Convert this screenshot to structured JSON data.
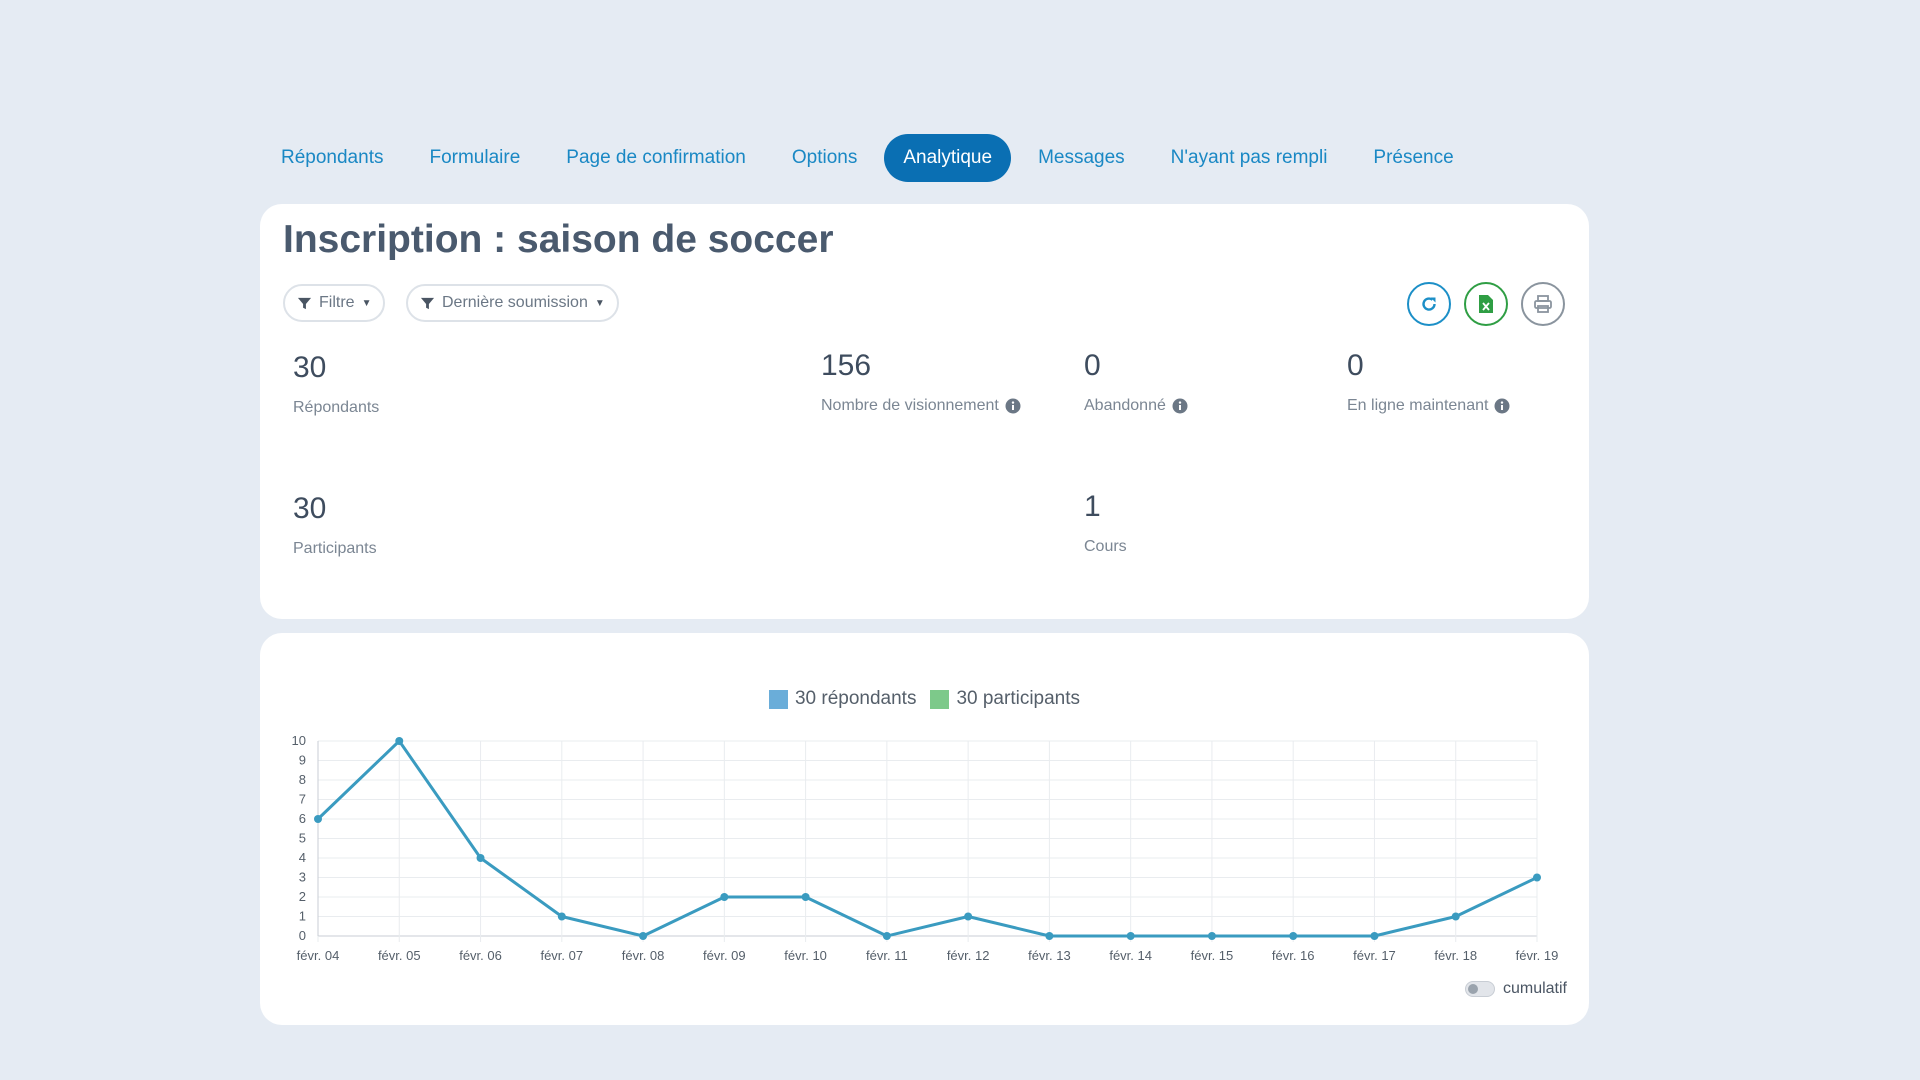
{
  "tabs": [
    {
      "label": "Répondants",
      "active": false
    },
    {
      "label": "Formulaire",
      "active": false
    },
    {
      "label": "Page de confirmation",
      "active": false
    },
    {
      "label": "Options",
      "active": false
    },
    {
      "label": "Analytique",
      "active": true
    },
    {
      "label": "Messages",
      "active": false
    },
    {
      "label": "N'ayant pas rempli",
      "active": false
    },
    {
      "label": "Présence",
      "active": false
    }
  ],
  "summary": {
    "title": "Inscription : saison de soccer",
    "filter_label": "Filtre",
    "sort_label": "Dernière soumission",
    "actions": {
      "refresh_icon": "refresh-icon",
      "excel_icon": "excel-icon",
      "print_icon": "print-icon"
    },
    "stats": {
      "respondents": {
        "value": "30",
        "label": "Répondants"
      },
      "views": {
        "value": "156",
        "label": "Nombre de visionnement"
      },
      "abandoned": {
        "value": "0",
        "label": "Abandonné"
      },
      "online": {
        "value": "0",
        "label": "En ligne maintenant"
      },
      "participants": {
        "value": "30",
        "label": "Participants"
      },
      "courses": {
        "value": "1",
        "label": "Cours"
      }
    }
  },
  "colors": {
    "accent": "#0a6fb3",
    "tab_text": "#1a88c4",
    "refresh": "#1c8fc7",
    "excel": "#2f9e44",
    "print": "#8a949e",
    "line": "#3a9bc0",
    "legend_respondents": "#6aadd9",
    "legend_participants": "#7dc98a"
  },
  "chart_data": {
    "type": "line",
    "categories": [
      "févr. 04",
      "févr. 05",
      "févr. 06",
      "févr. 07",
      "févr. 08",
      "févr. 09",
      "févr. 10",
      "févr. 11",
      "févr. 12",
      "févr. 13",
      "févr. 14",
      "févr. 15",
      "févr. 16",
      "févr. 17",
      "févr. 18",
      "févr. 19"
    ],
    "series": [
      {
        "name": "30 répondants",
        "values": [
          6,
          10,
          4,
          1,
          0,
          2,
          2,
          0,
          1,
          0,
          0,
          0,
          0,
          0,
          1,
          3
        ]
      },
      {
        "name": "30 participants",
        "values": [
          6,
          10,
          4,
          1,
          0,
          2,
          2,
          0,
          1,
          0,
          0,
          0,
          0,
          0,
          1,
          3
        ]
      }
    ],
    "ylim": [
      0,
      10
    ],
    "yticks": [
      0,
      1,
      2,
      3,
      4,
      5,
      6,
      7,
      8,
      9,
      10
    ],
    "grid": true,
    "legend": "top-center",
    "title": "",
    "xlabel": "",
    "ylabel": ""
  },
  "cumulative_label": "cumulatif"
}
